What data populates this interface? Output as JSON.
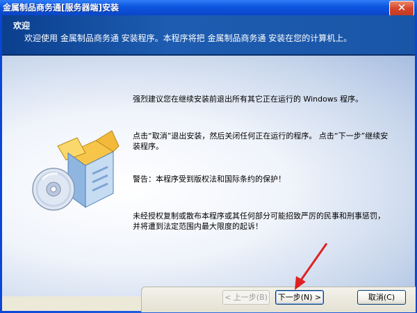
{
  "window": {
    "title": "金属制品商务通[服务器端]安装",
    "close_glyph": "✕"
  },
  "header": {
    "title": "欢迎",
    "subtitle": "欢迎使用 金属制品商务通 安装程序。本程序将把 金属制品商务通 安装在您的计算机上。"
  },
  "body": {
    "paragraphs": [
      "强烈建议您在继续安装前退出所有其它正在运行的 Windows 程序。",
      "点击“取消”退出安装，然后关闭任何正在运行的程序。 点击“下一步”继续安装程序。",
      "警告：本程序受到版权法和国际条约的保护！",
      "未经授权复制或散布本程序或其任何部分可能招致严厉的民事和刑事惩罚，并将遭到法定范围内最大限度的起诉！"
    ]
  },
  "buttons": {
    "back": "< 上一步(B)",
    "next": "下一步(N) >",
    "cancel": "取消(C)"
  },
  "icons": {
    "graphic": "box-with-disc-icon",
    "annotation": "red-arrow-icon"
  },
  "colors": {
    "header_bg": "#0b3f8e",
    "title_bar": "#0a46d6",
    "arrow": "#e02020"
  }
}
